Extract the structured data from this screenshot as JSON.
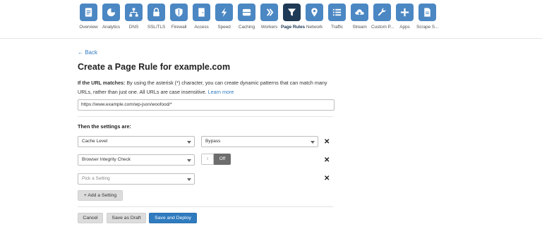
{
  "nav": {
    "items": [
      {
        "label": "Overview",
        "icon": "document-icon"
      },
      {
        "label": "Analytics",
        "icon": "pie-chart-icon"
      },
      {
        "label": "DNS",
        "icon": "network-tree-icon"
      },
      {
        "label": "SSL/TLS",
        "icon": "lock-icon"
      },
      {
        "label": "Firewall",
        "icon": "shield-icon"
      },
      {
        "label": "Access",
        "icon": "door-icon"
      },
      {
        "label": "Speed",
        "icon": "lightning-icon"
      },
      {
        "label": "Caching",
        "icon": "server-icon"
      },
      {
        "label": "Workers",
        "icon": "workers-icon"
      },
      {
        "label": "Page Rules",
        "icon": "filter-icon",
        "active": true
      },
      {
        "label": "Network",
        "icon": "location-pin-icon"
      },
      {
        "label": "Traffic",
        "icon": "list-icon"
      },
      {
        "label": "Stream",
        "icon": "cloud-upload-icon"
      },
      {
        "label": "Custom P...",
        "icon": "wrench-icon"
      },
      {
        "label": "Apps",
        "icon": "plus-icon"
      },
      {
        "label": "Scrape S...",
        "icon": "page-icon"
      }
    ],
    "accent": "#4b87c3",
    "active_color": "#1e3a56"
  },
  "page": {
    "back_label": "← Back",
    "title": "Create a Page Rule for example.com",
    "desc_strong": "If the URL matches:",
    "desc_text": " By using the asterisk (*) character, you can create dynamic patterns that can match many URLs, rather than just one. All URLs are case insensitive. ",
    "desc_link": "Learn more",
    "url_value": "https://www.example.com/wp-json/woofood/*",
    "settings_heading": "Then the settings are:"
  },
  "settings": {
    "row1_setting": "Cache Level",
    "row1_value": "Bypass",
    "row2_setting": "Browser Integrity Check",
    "row2_toggle_state": "Off",
    "row3_placeholder": "Pick a Setting",
    "remove_glyph": "✕",
    "add_label": "+ Add a Setting"
  },
  "actions": {
    "cancel_label": "Cancel",
    "draft_label": "Save as Draft",
    "deploy_label": "Save and Deploy"
  }
}
